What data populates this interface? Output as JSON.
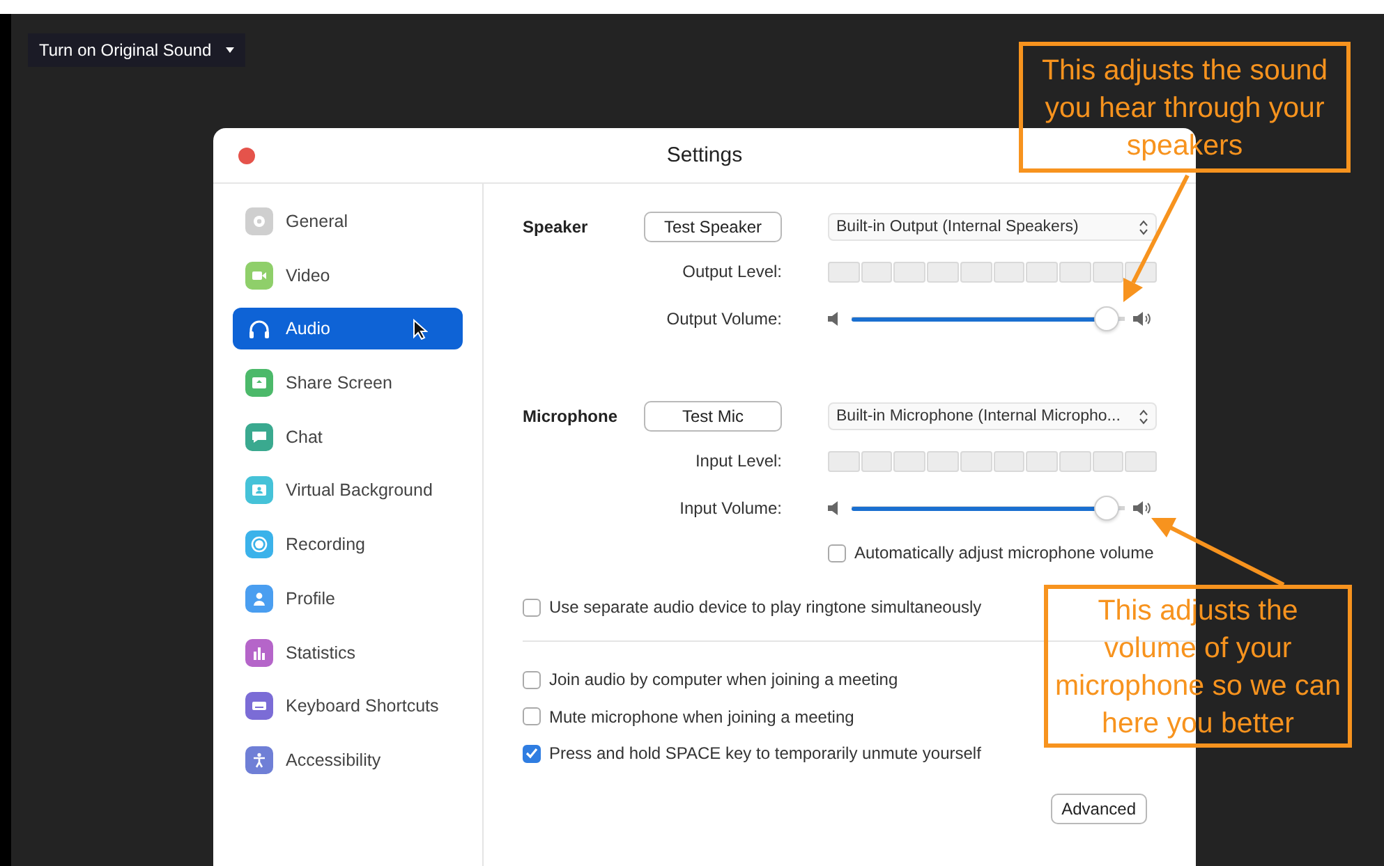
{
  "top_bar": {
    "button": "Turn on Original Sound"
  },
  "window": {
    "title": "Settings"
  },
  "sidebar": {
    "items": [
      {
        "label": "General",
        "selected": false
      },
      {
        "label": "Video",
        "selected": false
      },
      {
        "label": "Audio",
        "selected": true
      },
      {
        "label": "Share Screen",
        "selected": false
      },
      {
        "label": "Chat",
        "selected": false
      },
      {
        "label": "Virtual Background",
        "selected": false
      },
      {
        "label": "Recording",
        "selected": false
      },
      {
        "label": "Profile",
        "selected": false
      },
      {
        "label": "Statistics",
        "selected": false
      },
      {
        "label": "Keyboard Shortcuts",
        "selected": false
      },
      {
        "label": "Accessibility",
        "selected": false
      }
    ]
  },
  "speaker": {
    "heading": "Speaker",
    "test_button": "Test Speaker",
    "device": "Built-in Output (Internal Speakers)",
    "meter": {
      "label": "Output Level:"
    },
    "volume": {
      "label": "Output Volume:",
      "level": 0.98
    }
  },
  "microphone": {
    "heading": "Microphone",
    "test_button": "Test Mic",
    "device": "Built-in Microphone (Internal Micropho...",
    "meter": {
      "label": "Input Level:"
    },
    "volume": {
      "label": "Input Volume:",
      "level": 0.98
    },
    "auto_adjust": {
      "label": "Automatically adjust microphone volume",
      "checked": false
    }
  },
  "ringtone_option": {
    "label": "Use separate audio device to play ringtone simultaneously",
    "checked": false
  },
  "meeting_options": [
    {
      "label": "Join audio by computer when joining a meeting",
      "checked": false
    },
    {
      "label": "Mute microphone when joining a meeting",
      "checked": false
    },
    {
      "label": "Press and hold SPACE key to temporarily unmute yourself",
      "checked": true
    }
  ],
  "advanced_button": "Advanced",
  "callouts": [
    {
      "text": "This adjusts the sound you hear through your speakers"
    },
    {
      "text": "This adjusts the volume of your microphone so we can here you better"
    }
  ]
}
